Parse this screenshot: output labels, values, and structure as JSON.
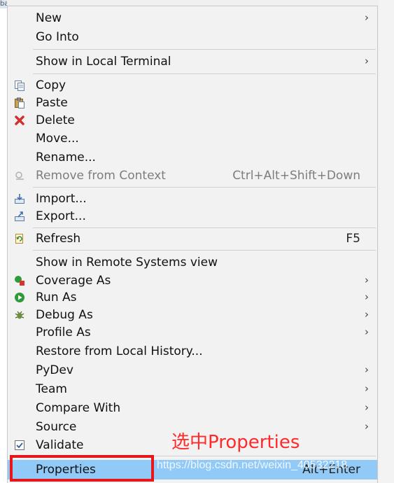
{
  "menu": {
    "items": [
      {
        "label": "New",
        "submenu": true
      },
      {
        "label": "Go Into"
      },
      {
        "label": "Show in Local Terminal",
        "submenu": true
      },
      {
        "label": "Copy",
        "icon": "copy-icon"
      },
      {
        "label": "Paste",
        "icon": "paste-icon"
      },
      {
        "label": "Delete",
        "icon": "delete-icon"
      },
      {
        "label": "Move..."
      },
      {
        "label": "Rename..."
      },
      {
        "label": "Remove from Context",
        "shortcut": "Ctrl+Alt+Shift+Down",
        "disabled": true,
        "icon": "remove-context-icon"
      },
      {
        "label": "Import...",
        "icon": "import-icon"
      },
      {
        "label": "Export...",
        "icon": "export-icon"
      },
      {
        "label": "Refresh",
        "shortcut": "F5",
        "icon": "refresh-icon"
      },
      {
        "label": "Show in Remote Systems view"
      },
      {
        "label": "Coverage As",
        "submenu": true,
        "icon": "coverage-icon"
      },
      {
        "label": "Run As",
        "submenu": true,
        "icon": "run-icon"
      },
      {
        "label": "Debug As",
        "submenu": true,
        "icon": "debug-icon"
      },
      {
        "label": "Profile As",
        "submenu": true
      },
      {
        "label": "Restore from Local History..."
      },
      {
        "label": "PyDev",
        "submenu": true
      },
      {
        "label": "Team",
        "submenu": true
      },
      {
        "label": "Compare With",
        "submenu": true
      },
      {
        "label": "Source",
        "submenu": true
      },
      {
        "label": "Validate",
        "checked": true,
        "icon": "checkbox-icon"
      },
      {
        "label": "Properties",
        "shortcut": "Alt+Enter",
        "selected": true
      }
    ],
    "arrow_glyph": "›"
  },
  "annotation": {
    "text": "选中Properties",
    "color": "#ff2a2a"
  },
  "watermark": {
    "text": "https://blog.csdn.net/weixin_40532218"
  },
  "colors": {
    "menu_bg": "#f2f2f2",
    "selected_bg": "#91c9f7",
    "highlight_box": "#e8161b",
    "disabled_text": "#7d7d7d"
  }
}
